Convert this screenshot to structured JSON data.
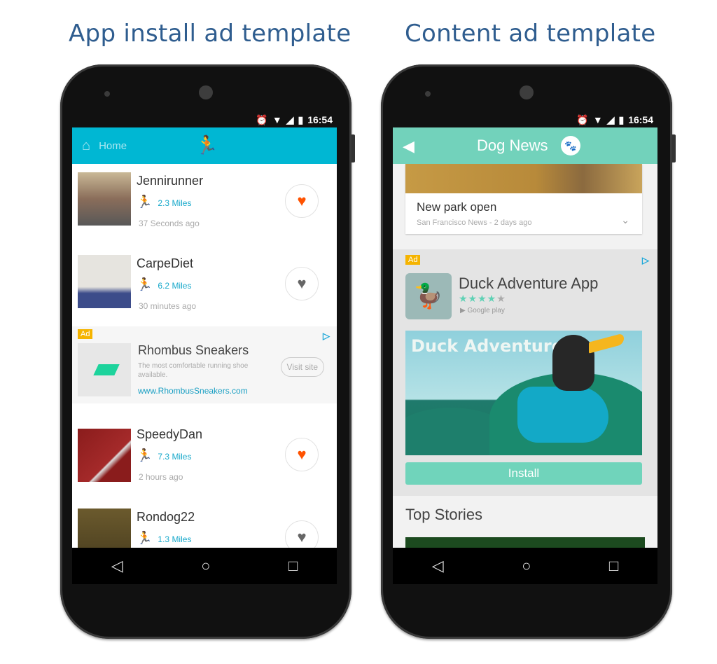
{
  "headings": {
    "left": "App install ad template",
    "right": "Content ad template"
  },
  "status_bar": {
    "time": "16:54",
    "icons": [
      "alarm-icon",
      "wifi-icon",
      "signal-icon",
      "battery-icon"
    ]
  },
  "nav_bar": {
    "back": "◁",
    "home": "○",
    "recents": "□"
  },
  "left_phone": {
    "appbar": {
      "home_label": "Home",
      "home_icon": "⌂",
      "runner_icon": "🏃"
    },
    "feed": [
      {
        "name": "Jennirunner",
        "miles": "2.3 Miles",
        "ago": "37 Seconds ago",
        "liked": true
      },
      {
        "name": "CarpeDiet",
        "miles": "6.2 Miles",
        "ago": "30 minutes ago",
        "liked": false
      },
      {
        "name": "SpeedyDan",
        "miles": "7.3 Miles",
        "ago": "2 hours ago",
        "liked": true
      },
      {
        "name": "Rondog22",
        "miles": "1.3 Miles",
        "ago": "",
        "liked": false
      }
    ],
    "ad": {
      "badge": "Ad",
      "title": "Rhombus Sneakers",
      "description": "The most comfortable running shoe available.",
      "url": "www.RhombusSneakers.com",
      "cta": "Visit site"
    }
  },
  "right_phone": {
    "appbar": {
      "back_icon": "◀",
      "title": "Dog News",
      "paw_icon": "🐾"
    },
    "story": {
      "headline": "New park open",
      "source": "San Francisco News  - 2 days ago"
    },
    "ad": {
      "badge": "Ad",
      "app_title": "Duck Adventure App",
      "rating": 4,
      "rating_max": 5,
      "store": "Google play",
      "banner_title": "Duck Adventure",
      "cta": "Install"
    },
    "section_title": "Top Stories"
  },
  "colors": {
    "heading": "#2f5d8f",
    "left_appbar": "#00b7d3",
    "right_appbar": "#72d2bb",
    "like_active": "#ff5200",
    "like_inactive": "#666666",
    "link": "#18a9cb",
    "ad_badge": "#f5b400"
  }
}
